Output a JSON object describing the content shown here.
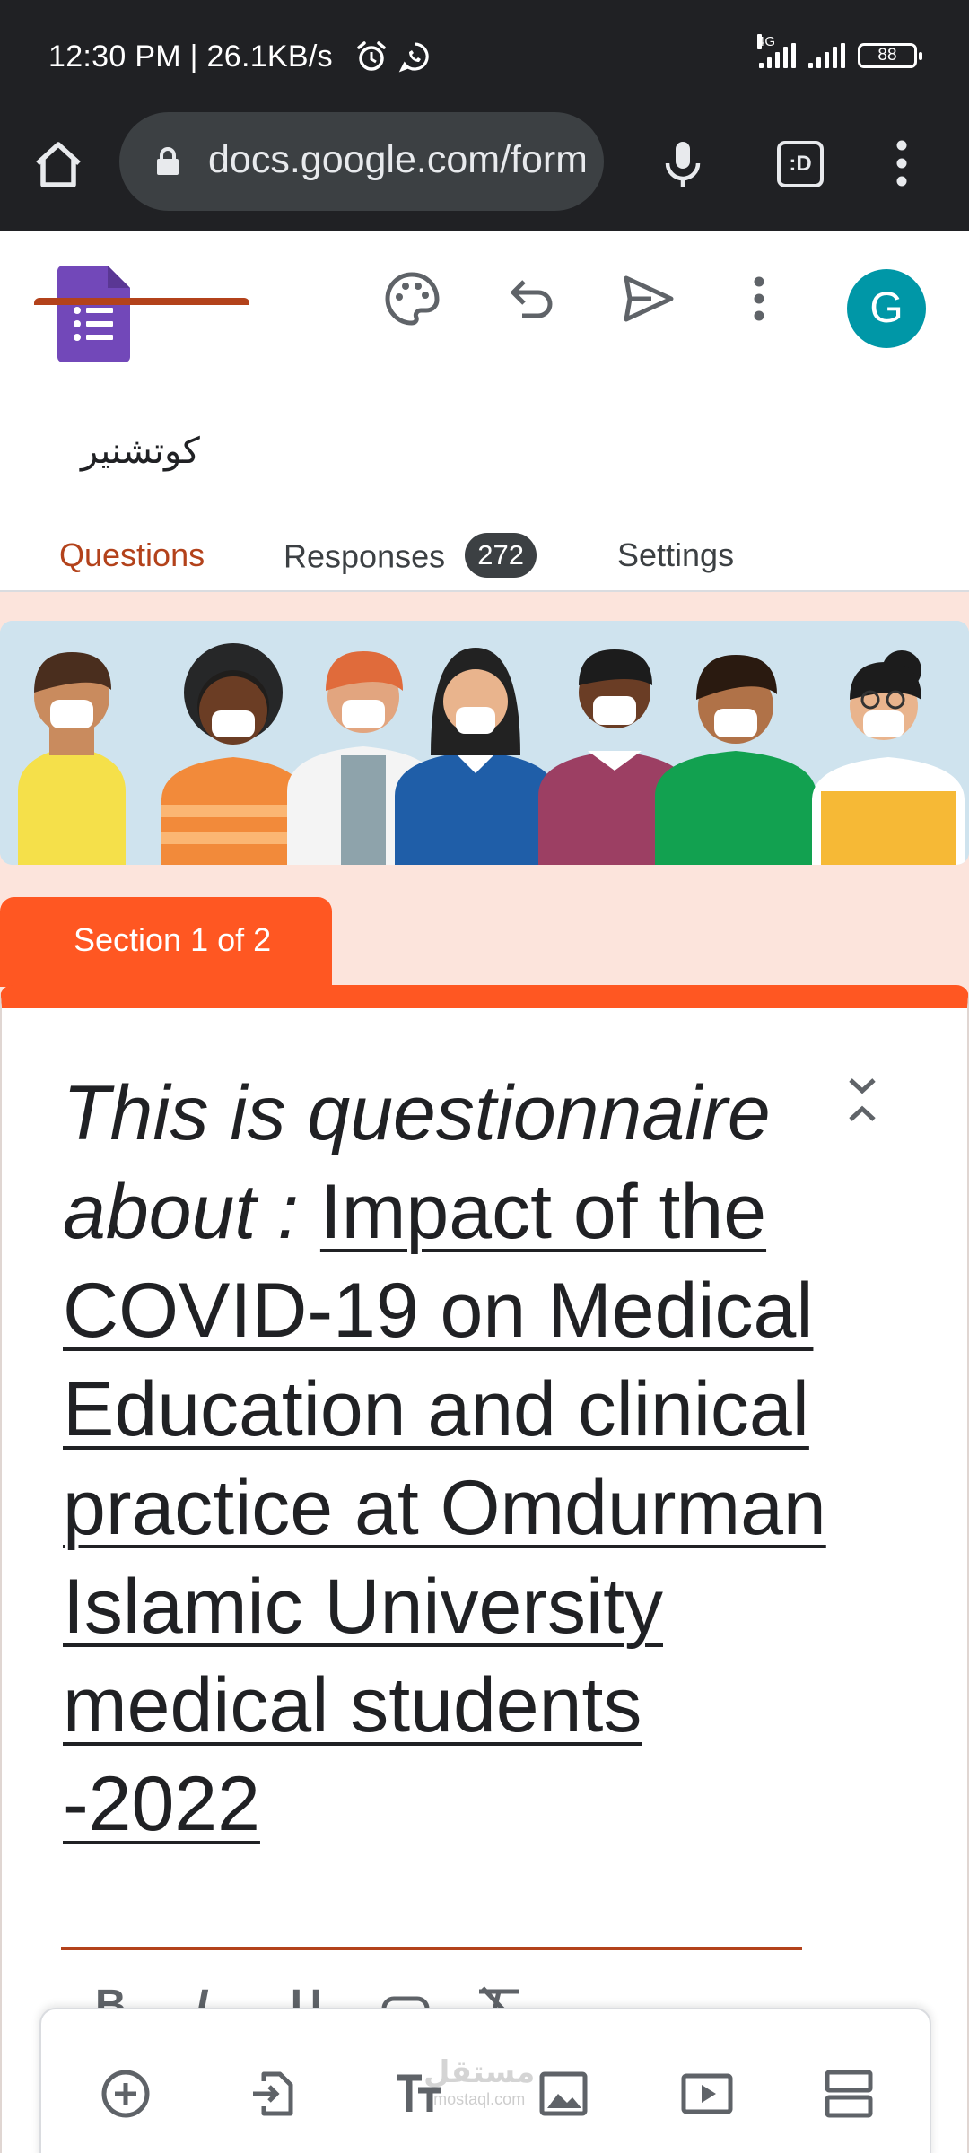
{
  "status_bar": {
    "time_speed": "12:30 PM | 26.1KB/s",
    "network_label": "4G",
    "battery": "88",
    "icons": [
      "alarm-icon",
      "whatsapp-icon",
      "signal-icon",
      "battery-icon"
    ]
  },
  "browser": {
    "url": "docs.google.com/forms",
    "tabs_label": ":D",
    "icons": [
      "home-icon",
      "lock-icon",
      "mic-icon",
      "tabs-icon",
      "more-vert-icon"
    ]
  },
  "app_header": {
    "form_title": "كوتشنير",
    "avatar_letter": "G",
    "icons": [
      "palette-icon",
      "undo-icon",
      "send-icon",
      "more-vert-icon"
    ],
    "tabs": [
      {
        "label": "Questions",
        "active": true
      },
      {
        "label": "Responses",
        "badge": "272",
        "active": false
      },
      {
        "label": "Settings",
        "active": false
      }
    ]
  },
  "form": {
    "section_label": "Section 1 of 2",
    "heading_prefix": "This is questionnaire about : ",
    "heading_title": " Impact of the COVID-19 on Medical Education and clinical practice at Omdurman Islamic University medical students -2022",
    "format_buttons": [
      "B",
      "I",
      "U",
      "link",
      "clear-format"
    ],
    "colors": {
      "accent": "#ff5722",
      "tab_active": "#b3421b",
      "background": "#fce4dc",
      "avatar": "#0097a7",
      "logo": "#7248b9"
    }
  },
  "toolbar": {
    "tools": [
      "add-question-icon",
      "import-questions-icon",
      "add-title-icon",
      "add-image-icon",
      "add-video-icon",
      "add-section-icon"
    ]
  },
  "watermark": {
    "arabic": "مستقل",
    "latin": "mostaql.com"
  }
}
